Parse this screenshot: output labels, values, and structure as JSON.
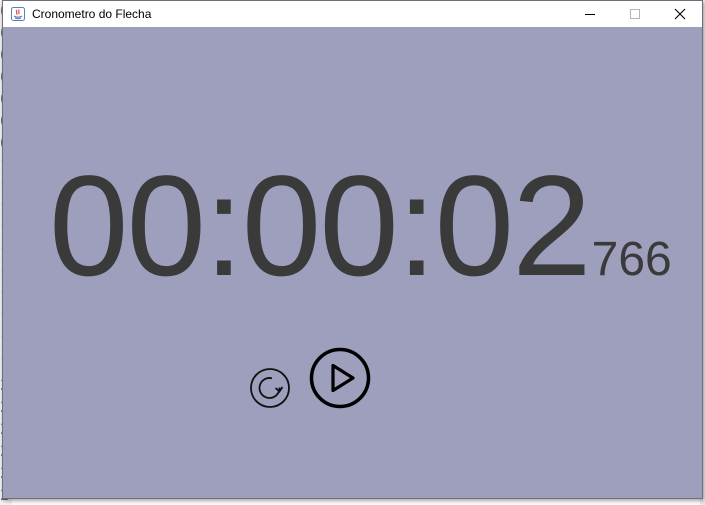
{
  "window": {
    "title": "Cronometro do Flecha",
    "background_color": "#9d9fbd"
  },
  "background_editor": {
    "gutter_lines": [
      "0",
      "0",
      "0",
      "0",
      "0",
      "0",
      "0",
      "1",
      "1",
      "1",
      "1",
      "1",
      "1",
      "1",
      "1",
      "1",
      "1",
      "2",
      "2",
      "2",
      "2",
      "2",
      "2",
      "2"
    ]
  },
  "stopwatch": {
    "time_main": "00:00:02",
    "milliseconds": "766",
    "text_color": "#3a3a3a"
  },
  "controls": {
    "reset_icon": "reset-icon",
    "play_icon": "play-icon"
  },
  "titlebar_icons": {
    "app": "java-app-icon",
    "minimize": "minimize-icon",
    "maximize": "maximize-icon",
    "close": "close-icon"
  }
}
